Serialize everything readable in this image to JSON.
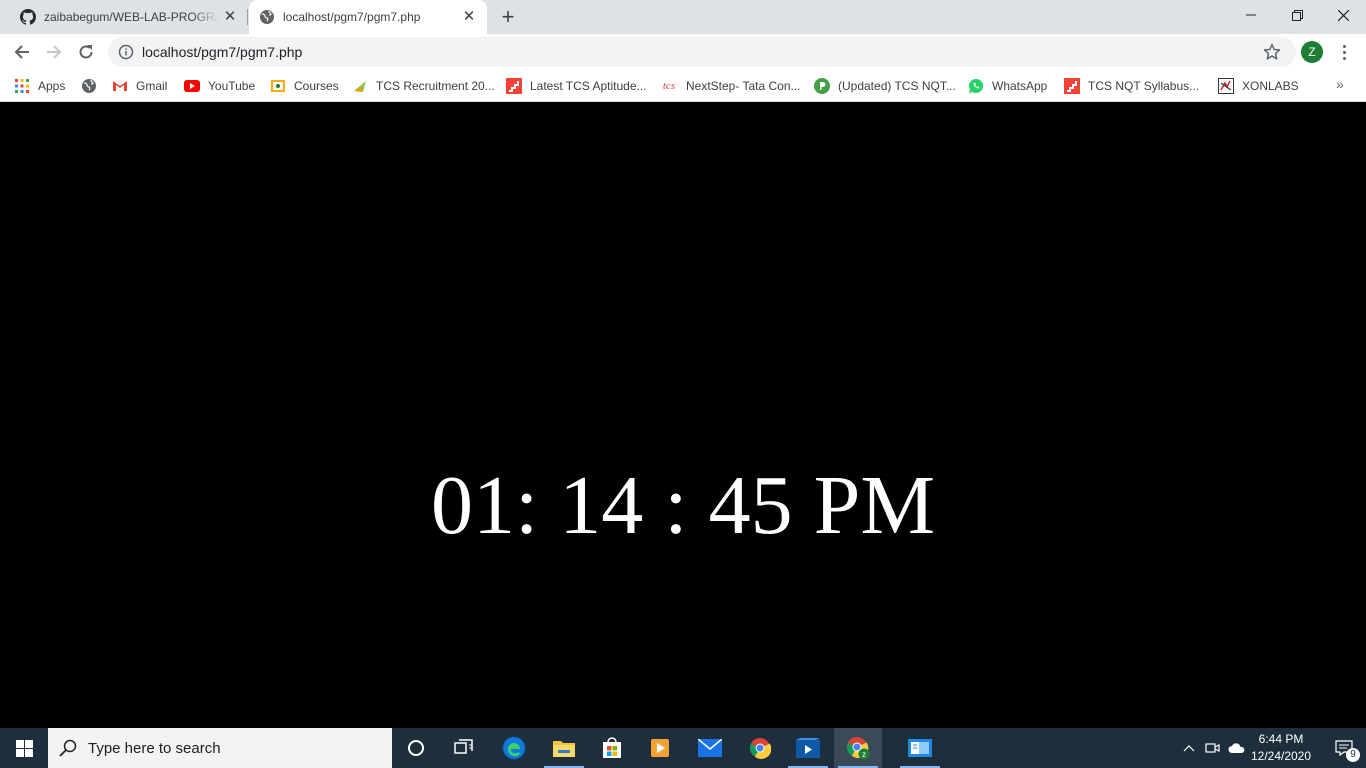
{
  "browser": {
    "tabs": [
      {
        "title": "zaibabegum/WEB-LAB-PROGRAMS",
        "icon": "github-icon",
        "active": false
      },
      {
        "title": "localhost/pgm7/pgm7.php",
        "icon": "globe-icon",
        "active": true
      }
    ],
    "address": "localhost/pgm7/pgm7.php",
    "profile_initial": "Z",
    "bookmarks": [
      {
        "label": "Apps",
        "icon": "apps-grid-icon"
      },
      {
        "label": "",
        "icon": "globe-icon"
      },
      {
        "label": "Gmail",
        "icon": "gmail-icon"
      },
      {
        "label": "YouTube",
        "icon": "youtube-icon"
      },
      {
        "label": "Courses",
        "icon": "courses-icon"
      },
      {
        "label": "TCS Recruitment 20...",
        "icon": "tcs-recruitment-icon"
      },
      {
        "label": "Latest TCS Aptitude...",
        "icon": "aptitude-icon"
      },
      {
        "label": "NextStep- Tata Con...",
        "icon": "tcs-icon"
      },
      {
        "label": "(Updated) TCS NQT...",
        "icon": "prep-icon"
      },
      {
        "label": "WhatsApp",
        "icon": "whatsapp-icon"
      },
      {
        "label": "TCS NQT Syllabus...",
        "icon": "syllabus-icon"
      },
      {
        "label": "XONLABS",
        "icon": "xonlabs-icon"
      }
    ]
  },
  "page": {
    "clock_text": "01: 14 : 45 PM"
  },
  "taskbar": {
    "search_placeholder": "Type here to search",
    "time": "6:44 PM",
    "date": "12/24/2020",
    "notification_count": "9"
  },
  "colors": {
    "tabstrip": "#dee1e6",
    "page_background": "#000000",
    "clock_text": "#ffffff",
    "taskbar": "#1f2e3c"
  }
}
